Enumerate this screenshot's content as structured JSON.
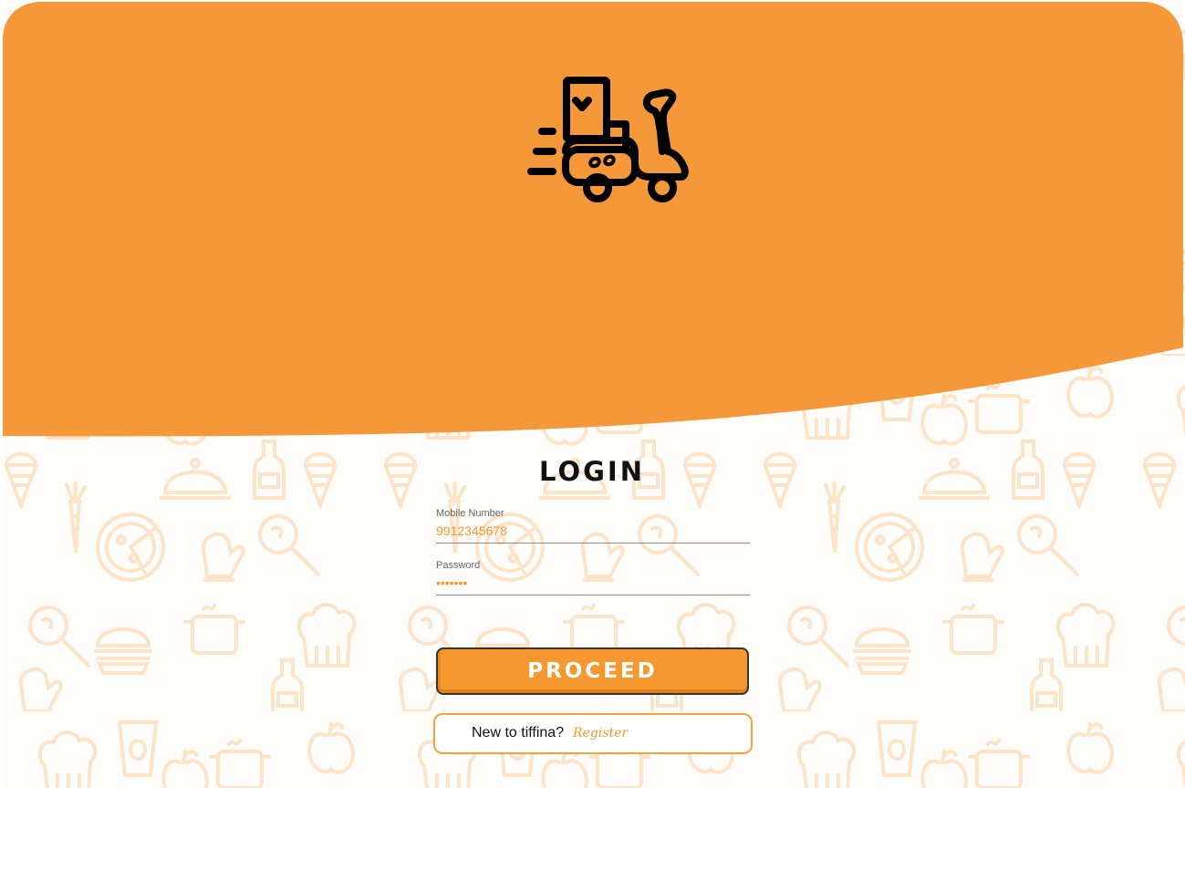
{
  "app": {
    "name": "tiffina",
    "logo_icon": "delivery-scooter-icon"
  },
  "colors": {
    "brand": "#f5982f",
    "pattern": "#fde5cc",
    "text": "#111111"
  },
  "login": {
    "title": "LOGIN",
    "mobile": {
      "label": "Mobile Number",
      "value": "9912345678"
    },
    "password": {
      "label": "Password",
      "value": "•••••••"
    },
    "proceed_label": "PROCEED"
  },
  "register": {
    "prompt": "New to tiffina?",
    "link_label": "Register"
  }
}
